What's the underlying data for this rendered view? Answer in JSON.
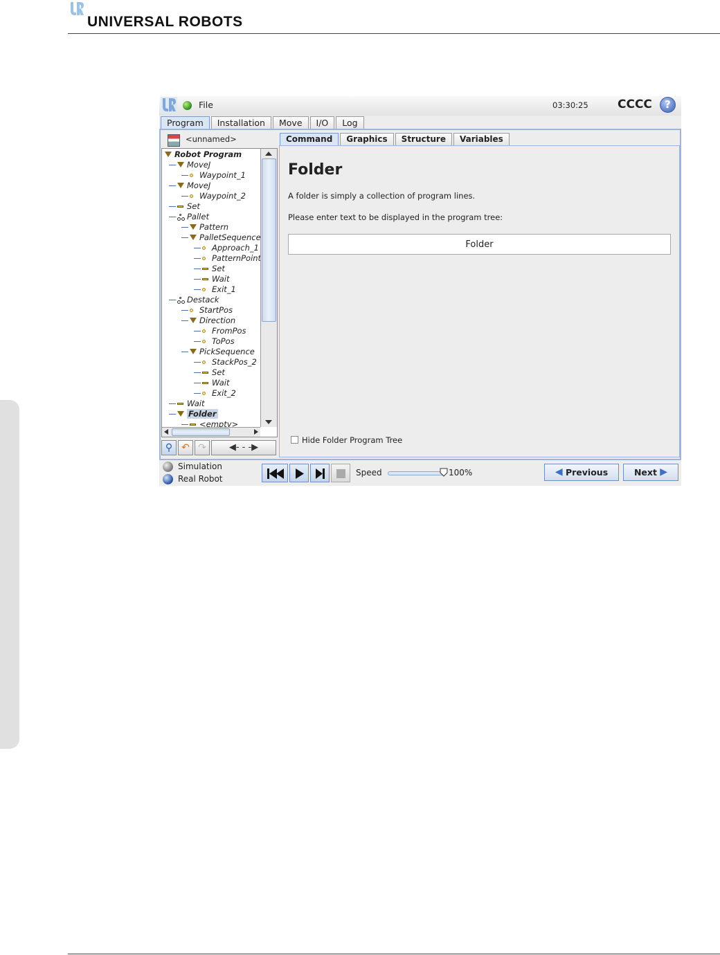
{
  "manual": {
    "brand": "UNIVERSAL ROBOTS"
  },
  "app": {
    "file_menu": "File",
    "clock": "03:30:25",
    "robot_name": "CCCC",
    "help": "?",
    "main_tabs": [
      "Program",
      "Installation",
      "Move",
      "I/O",
      "Log"
    ],
    "active_main_tab": "Program",
    "program_name": "<unnamed>",
    "tree": [
      {
        "label": "Robot Program",
        "depth": 0,
        "icon": "tri",
        "bold": true
      },
      {
        "label": "MoveJ",
        "depth": 1,
        "icon": "tri"
      },
      {
        "label": "Waypoint_1",
        "depth": 2,
        "icon": "wp"
      },
      {
        "label": "MoveJ",
        "depth": 1,
        "icon": "tri"
      },
      {
        "label": "Waypoint_2",
        "depth": 2,
        "icon": "wp"
      },
      {
        "label": "Set",
        "depth": 1,
        "icon": "bar"
      },
      {
        "label": "Pallet",
        "depth": 1,
        "icon": "net"
      },
      {
        "label": "Pattern",
        "depth": 2,
        "icon": "tri"
      },
      {
        "label": "PalletSequence",
        "depth": 2,
        "icon": "tri"
      },
      {
        "label": "Approach_1",
        "depth": 3,
        "icon": "wp"
      },
      {
        "label": "PatternPoint",
        "depth": 3,
        "icon": "wp"
      },
      {
        "label": "Set",
        "depth": 3,
        "icon": "bar"
      },
      {
        "label": "Wait",
        "depth": 3,
        "icon": "bar"
      },
      {
        "label": "Exit_1",
        "depth": 3,
        "icon": "wp"
      },
      {
        "label": "Destack",
        "depth": 1,
        "icon": "net"
      },
      {
        "label": "StartPos",
        "depth": 2,
        "icon": "wp"
      },
      {
        "label": "Direction",
        "depth": 2,
        "icon": "tri"
      },
      {
        "label": "FromPos",
        "depth": 3,
        "icon": "wp"
      },
      {
        "label": "ToPos",
        "depth": 3,
        "icon": "wp"
      },
      {
        "label": "PickSequence",
        "depth": 2,
        "icon": "tri"
      },
      {
        "label": "StackPos_2",
        "depth": 3,
        "icon": "wp"
      },
      {
        "label": "Set",
        "depth": 3,
        "icon": "bar"
      },
      {
        "label": "Wait",
        "depth": 3,
        "icon": "bar"
      },
      {
        "label": "Exit_2",
        "depth": 3,
        "icon": "wp"
      },
      {
        "label": "Wait",
        "depth": 1,
        "icon": "bar"
      },
      {
        "label": "Folder",
        "depth": 1,
        "icon": "tri",
        "selected": true
      },
      {
        "label": "<empty>",
        "depth": 2,
        "icon": "bar"
      }
    ],
    "sub_tabs": [
      "Command",
      "Graphics",
      "Structure",
      "Variables"
    ],
    "active_sub_tab": "Command",
    "command": {
      "title": "Folder",
      "description": "A folder is simply a collection of program lines.",
      "prompt": "Please enter text to be displayed in the program tree:",
      "name_value": "Folder",
      "hide_checkbox_label": "Hide Folder Program Tree",
      "hide_checked": false
    },
    "bottom": {
      "mode_simulation": "Simulation",
      "mode_real": "Real Robot",
      "speed_label": "Speed",
      "speed_value": "100%",
      "speed_fraction": 1.0,
      "previous": "Previous",
      "next": "Next"
    },
    "colors": {
      "accent": "#9bb6dc",
      "status_ok": "#2a8a1a"
    }
  }
}
